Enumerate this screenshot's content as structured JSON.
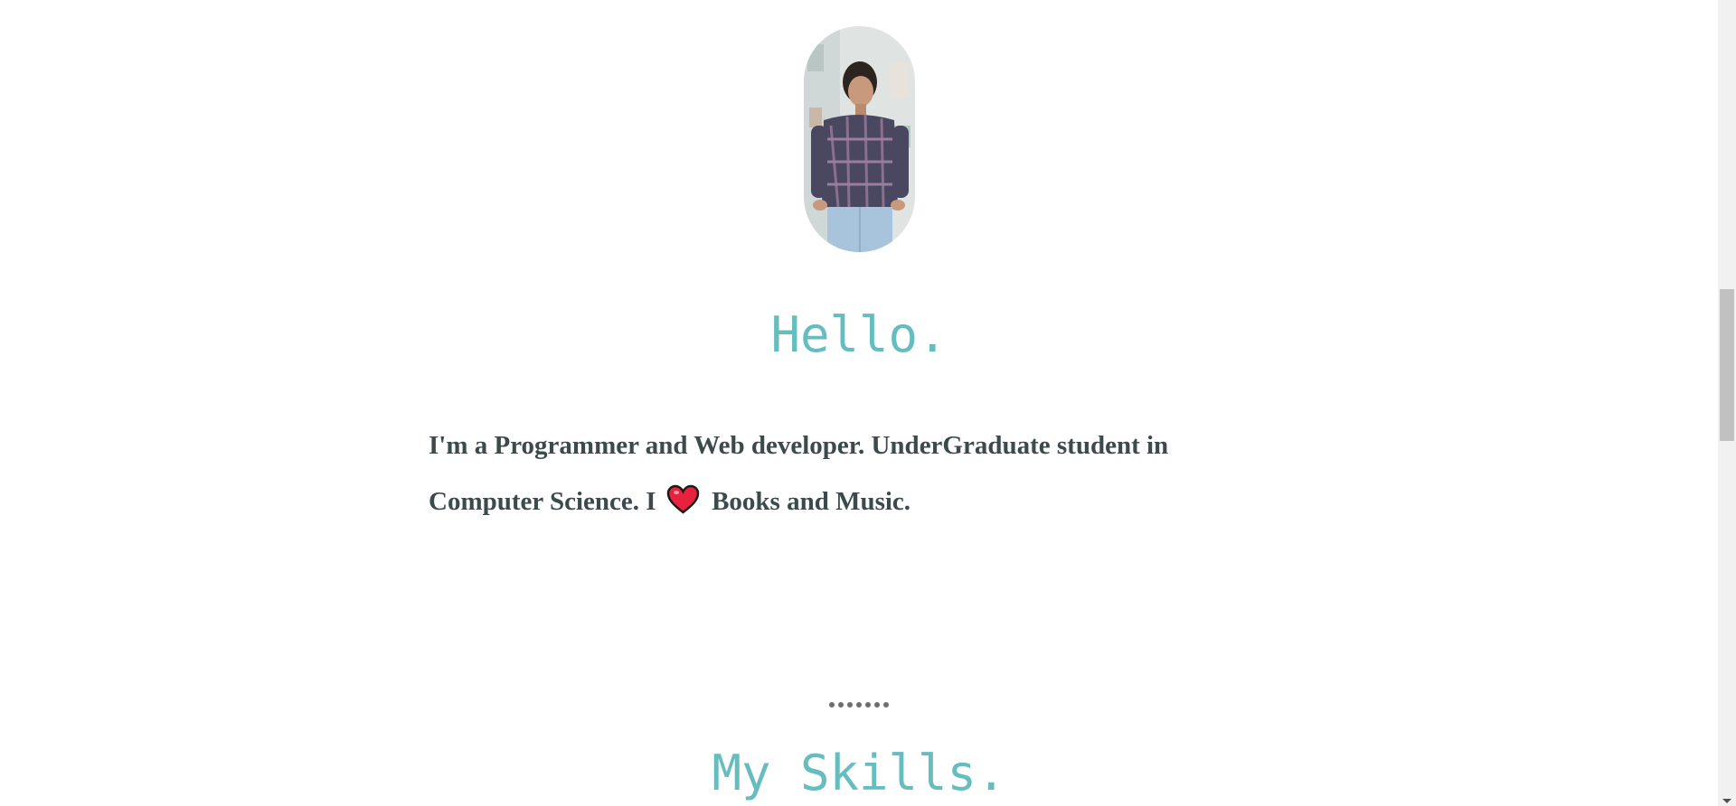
{
  "profile": {
    "photo_alt": "profile photo"
  },
  "hello": {
    "heading": "Hello."
  },
  "bio": {
    "part1": "I'm a Programmer and Web developer. UnderGraduate student in Computer Science. I",
    "heart_icon": "heart-icon",
    "part2": "Books and Music."
  },
  "skills": {
    "heading": "My Skills."
  },
  "colors": {
    "heading_accent": "#66bdc0",
    "body_text": "#3b4a4a",
    "heart": "#e8213f",
    "dots": "#6e6e6e"
  }
}
